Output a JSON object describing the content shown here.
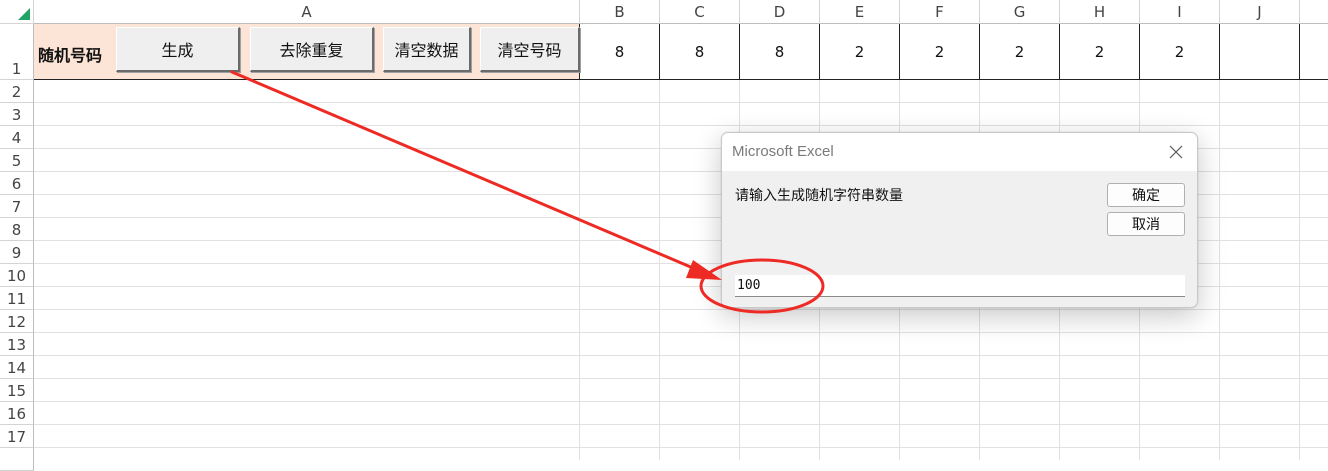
{
  "sheet": {
    "columns": [
      "A",
      "B",
      "C",
      "D",
      "E",
      "F",
      "G",
      "H",
      "I",
      "J"
    ],
    "rows": [
      "1",
      "2",
      "3",
      "4",
      "5",
      "6",
      "7",
      "8",
      "9",
      "10",
      "11",
      "12",
      "13",
      "14",
      "15",
      "16",
      "17"
    ],
    "a1_label": "随机号码",
    "buttons": {
      "generate": "生成",
      "dedupe": "去除重复",
      "clear_data": "清空数据",
      "clear_numbers": "清空号码"
    },
    "row1_values": [
      "8",
      "8",
      "8",
      "2",
      "2",
      "2",
      "2",
      "2"
    ]
  },
  "dialog": {
    "title": "Microsoft Excel",
    "prompt": "请输入生成随机字符串数量",
    "ok_label": "确定",
    "cancel_label": "取消",
    "input_value": "100"
  },
  "annotation": {
    "color": "#ee2a24"
  }
}
